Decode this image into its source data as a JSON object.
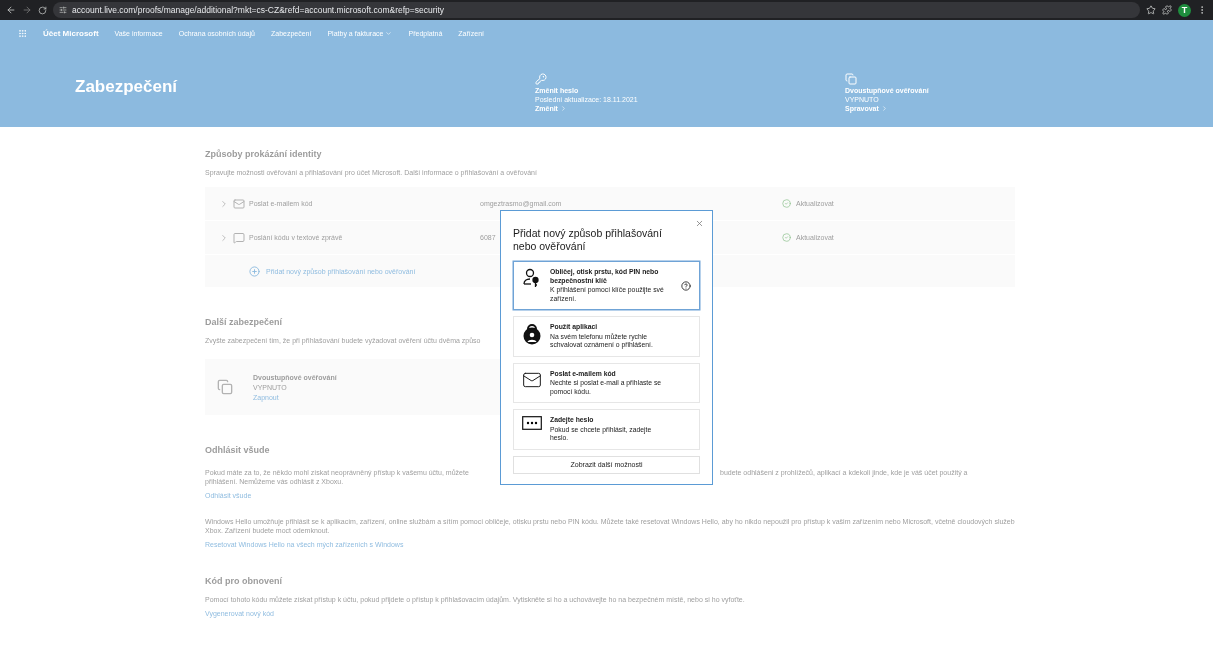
{
  "browser": {
    "url": "account.live.com/proofs/manage/additional?mkt=cs-CZ&refd=account.microsoft.com&refp=security",
    "avatar": "T"
  },
  "nav": {
    "brand": "Účet Microsoft",
    "items": [
      {
        "label": "Vaše informace",
        "kind": "link"
      },
      {
        "label": "Ochrana osobních údajů",
        "kind": "link"
      },
      {
        "label": "Zabezpečení",
        "kind": "link"
      },
      {
        "label": "Platby a fakturace",
        "kind": "dropdown"
      },
      {
        "label": "Předplatná",
        "kind": "link"
      },
      {
        "label": "Zařízení",
        "kind": "link"
      }
    ]
  },
  "hero": {
    "title": "Zabezpečení",
    "cards": [
      {
        "kind": "password",
        "title": "Změnit heslo",
        "subtitle": "Poslední aktualizace: 18.11.2021",
        "action": "Změnit"
      },
      {
        "kind": "twostep",
        "title": "Dvoustupňové ověřování",
        "subtitle": "VYPNUTO",
        "action": "Spravovat"
      }
    ]
  },
  "identity": {
    "heading": "Způsoby prokázání identity",
    "description": "Spravujte možnosti ověřování a přihlašování pro účet Microsoft. Další informace o přihlašování a ověřování",
    "methods": [
      {
        "kind": "email",
        "label": "Poslat e-mailem kód",
        "value": "omgeztrasmo@gmail.com",
        "status": "Aktualizovat"
      },
      {
        "kind": "sms",
        "label": "Poslání kódu v textové zprávě",
        "value": "6087",
        "status": "Aktualizovat"
      }
    ],
    "add_label": "Přidat nový způsob přihlašování nebo ověřování"
  },
  "extra": {
    "heading": "Další zabezpečení",
    "description": "Zvyšte zabezpečení tím, že při přihlašování budete vyžadovat ověření účtu dvěma způso",
    "card": {
      "title": "Dvoustupňové ověřování",
      "status": "VYPNUTO",
      "action": "Zapnout"
    }
  },
  "signout": {
    "heading": "Odhlásit všude",
    "line_left": "Pokud máte za to, že někdo mohl získat neoprávněný přístup k vašemu účtu, můžete",
    "line_right": "budete odhlášeni z prohlížečů, aplikací a kdekoli jinde, kde je váš účet použitý a",
    "line_2": "přihlášení. Nemůžeme vás odhlásit z Xboxu.",
    "link": "Odhlásit všude"
  },
  "hello": {
    "description": "Windows Hello umožňuje přihlásit se k aplikacím, zařízení, online službám a sítím pomocí obličeje, otisku prstu nebo PIN kódu. Můžete také resetovat Windows Hello, aby ho nikdo nepoužil pro přístup k vašim zařízením nebo Microsoft, včetně cloudových služeb Xbox. Zařízení budete moct odemknout.",
    "link": "Resetovat Windows Hello na všech mých zařízeních s Windows"
  },
  "recovery": {
    "heading": "Kód pro obnovení",
    "description": "Pomocí tohoto kódu můžete získat přístup k účtu, pokud přijdete o přístup k přihlašovacím údajům. Vytiskněte si ho a uchovávejte ho na bezpečném místě, nebo si ho vyfoťte.",
    "link": "Vygenerovat nový kód"
  },
  "dialog": {
    "title": "Přidat nový způsob přihlašování nebo ověřování",
    "options": [
      {
        "kind": "key",
        "title": "Obličej, otisk prstu, kód PIN nebo bezpečnostní klíč",
        "description": "K přihlášení pomocí klíče použijte své zařízení.",
        "selected": true
      },
      {
        "kind": "app",
        "title": "Použít aplikaci",
        "description": "Na svém telefonu můžete rychle schvalovat oznámení o přihlášení.",
        "selected": false
      },
      {
        "kind": "email",
        "title": "Poslat e-mailem kód",
        "description": "Nechte si poslat e-mail a přihlaste se pomocí kódu.",
        "selected": false
      },
      {
        "kind": "password",
        "title": "Zadejte heslo",
        "description": "Pokud se chcete přihlásit, zadejte heslo.",
        "selected": false
      }
    ],
    "more_button": "Zobrazit další možnosti"
  }
}
